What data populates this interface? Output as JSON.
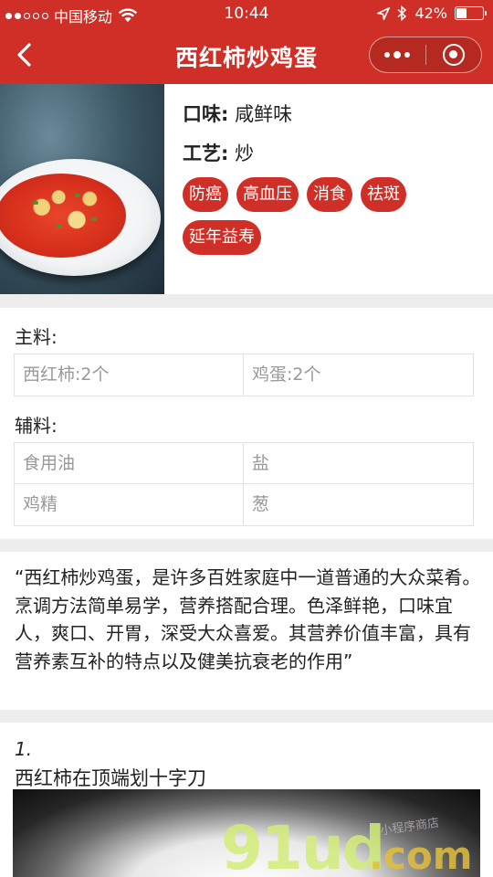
{
  "status_bar": {
    "carrier": "中国移动",
    "time": "10:44",
    "battery_text": "42%",
    "battery_level": 0.42
  },
  "nav": {
    "title": "西红柿炒鸡蛋",
    "back_icon": "chevron-left-icon",
    "more_icon": "more-dots-icon",
    "close_icon": "target-icon"
  },
  "info": {
    "taste_label": "口味:",
    "taste_value": "咸鲜味",
    "craft_label": "工艺:",
    "craft_value": "炒",
    "tags": [
      "防癌",
      "高血压",
      "消食",
      "祛斑",
      "延年益寿"
    ]
  },
  "ingredients": {
    "main_label": "主料:",
    "main": [
      "西红柿:2个",
      "鸡蛋:2个"
    ],
    "aux_label": "辅料:",
    "aux": [
      "食用油",
      "盐",
      "鸡精",
      "葱"
    ]
  },
  "description": "“西红柿炒鸡蛋，是许多百姓家庭中一道普通的大众菜肴。烹调方法简单易学，营养搭配合理。色泽鲜艳，口味宜人，爽口、开胃，深受大众喜爱。其营养价值丰富，具有营养素互补的特点以及健美抗衰老的作用”",
  "steps": [
    {
      "number": "1.",
      "text": "西红柿在顶端划十字刀"
    }
  ],
  "watermark": {
    "main": "91ud",
    "suffix": ".com",
    "stamp": "小程序商店"
  },
  "colors": {
    "brand_red": "#cf2f26",
    "divider_gray": "#ededed"
  }
}
